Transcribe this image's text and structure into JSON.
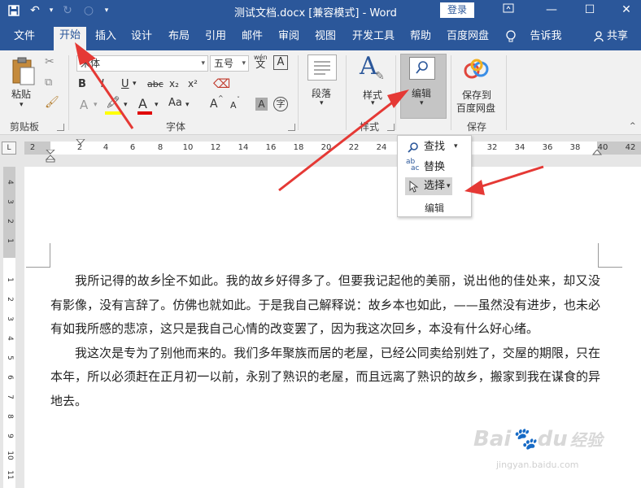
{
  "title_bar": {
    "title": "测试文档.docx [兼容模式] - Word",
    "login": "登录"
  },
  "tabs": [
    "文件",
    "开始",
    "插入",
    "设计",
    "布局",
    "引用",
    "邮件",
    "审阅",
    "视图",
    "开发工具",
    "帮助",
    "百度网盘"
  ],
  "active_tab": "开始",
  "tell_me": "告诉我",
  "share": "共享",
  "ribbon": {
    "clipboard": {
      "paste": "粘贴",
      "group": "剪贴板"
    },
    "font": {
      "font_name": "宋体",
      "font_size": "五号",
      "wen": "wén",
      "wen_char": "文",
      "A_box": "A",
      "bold": "B",
      "italic": "I",
      "underline": "U",
      "strike": "abc",
      "sub": "x₂",
      "sup": "x²",
      "case": "Aa",
      "grow": "A",
      "shrink": "A",
      "circle_char": "字",
      "group": "字体"
    },
    "paragraph": {
      "label": "段落"
    },
    "styles": {
      "label": "样式",
      "group": "样式"
    },
    "editing": {
      "label": "编辑"
    },
    "save": {
      "label_1": "保存到",
      "label_2": "百度网盘",
      "group": "保存"
    }
  },
  "dropdown": {
    "items": [
      "查找",
      "替换",
      "选择"
    ],
    "ab_icon": "ab",
    "ac_icon": "ac",
    "group": "编辑"
  },
  "ruler": {
    "corner": "L",
    "ticks": [
      "2",
      "2",
      "4",
      "6",
      "8",
      "10",
      "12",
      "14",
      "16",
      "18",
      "20",
      "22",
      "24",
      "32",
      "34",
      "36",
      "38",
      "40",
      "42"
    ],
    "vticks": [
      "4",
      "3",
      "2",
      "1",
      "1",
      "2",
      "3",
      "4",
      "5",
      "6",
      "7",
      "8",
      "9",
      "10",
      "11"
    ]
  },
  "document": {
    "p1_before": "我所记得的故乡",
    "p1_after": "全不如此。我的故乡好得多了。但要我记起他的美丽，说出他的佳处来，却又没有影像，没有言辞了。仿佛也就如此。于是我自己解释说：故乡本也如此，——虽然没有进步，也未必有如我所感的悲凉，这只是我自己心情的改变罢了，因为我这次回乡，本没有什么好心绪。",
    "p2": "我这次是专为了别他而来的。我们多年聚族而居的老屋，已经公同卖给别姓了，交屋的期限，只在本年，所以必须赶在正月初一以前，永别了熟识的老屋，而且远离了熟识的故乡，搬家到我在谋食的异地去。"
  },
  "watermark": {
    "brand": "Bai",
    "brand2": "du",
    "brand3": "经验",
    "url": "jingyan.baidu.com"
  },
  "colors": {
    "brand": "#2b579a",
    "arrow": "#e53935",
    "font_color_bar": "#e00000",
    "highlight_bar": "#ffff00"
  }
}
